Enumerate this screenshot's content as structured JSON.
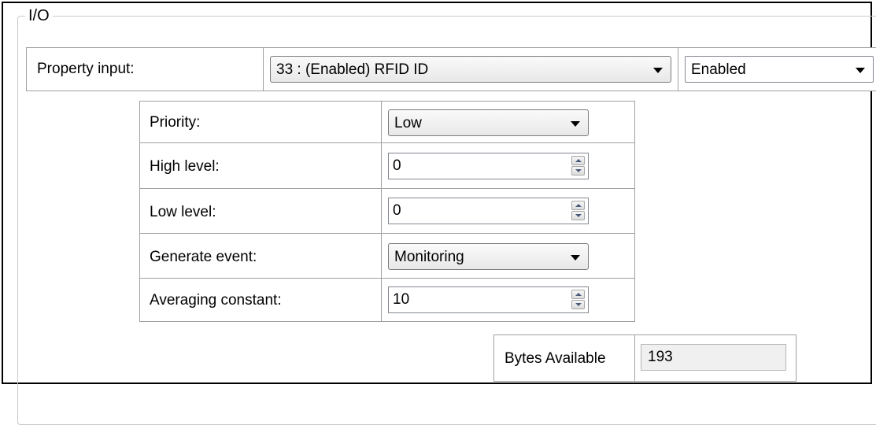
{
  "group": {
    "title": "I/O"
  },
  "property_input": {
    "label": "Property input:",
    "selected": "33 : (Enabled) RFID ID",
    "state_selected": "Enabled"
  },
  "settings": {
    "priority": {
      "label": "Priority:",
      "value": "Low"
    },
    "high_level": {
      "label": "High level:",
      "value": "0"
    },
    "low_level": {
      "label": "Low level:",
      "value": "0"
    },
    "generate_event": {
      "label": "Generate event:",
      "value": "Monitoring"
    },
    "averaging_constant": {
      "label": "Averaging constant:",
      "value": "10"
    }
  },
  "bytes_available": {
    "label": "Bytes Available",
    "value": "193"
  },
  "icons": {
    "dropdown": "chevron-down-icon",
    "spin_up": "spin-up-icon",
    "spin_down": "spin-down-icon"
  }
}
